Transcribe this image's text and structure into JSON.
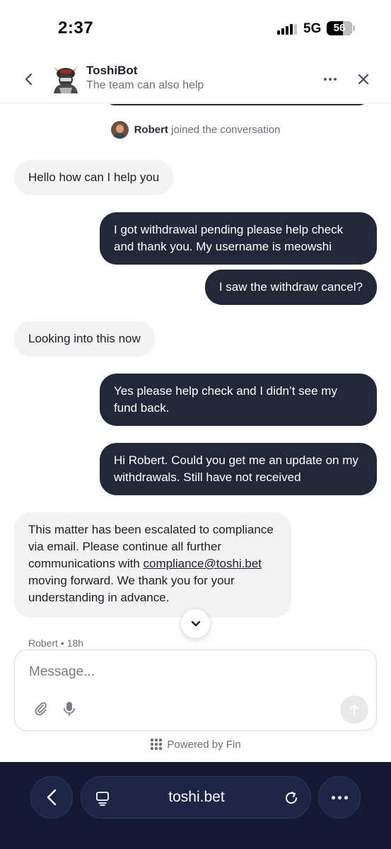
{
  "status_bar": {
    "time": "2:37",
    "network": "5G",
    "battery": "56",
    "icons": [
      "signal-icon",
      "battery-icon"
    ]
  },
  "header": {
    "bot_name": "ToshiBot",
    "subtitle": "The team can also help",
    "icons": [
      "back-chevron-icon",
      "bot-avatar",
      "more-dots-icon",
      "close-icon"
    ]
  },
  "conversation": {
    "join_notice": {
      "name": "Robert",
      "text": "joined the conversation"
    },
    "messages": [
      {
        "sender": "agent",
        "text": "Hello how can I help you"
      },
      {
        "sender": "user",
        "text": "I got withdrawal pending please help check and thank you. My username is meowshi"
      },
      {
        "sender": "user",
        "text": "I saw the withdraw cancel?"
      },
      {
        "sender": "agent",
        "text": "Looking into this now"
      },
      {
        "sender": "user",
        "text": "Yes please help check and I didn’t see my fund back."
      },
      {
        "sender": "user",
        "text": "Hi Robert. Could you get me an update on my withdrawals. Still have not received"
      },
      {
        "sender": "agent",
        "text_before": "This matter has been escalated to compliance via email. Please continue all further communications with ",
        "link": "compliance@toshi.bet",
        "text_after": " moving forward. We thank you for your understanding in advance."
      }
    ],
    "last_meta": "Robert • 18h"
  },
  "composer": {
    "placeholder": "Message...",
    "value": "",
    "icons": [
      "paperclip-icon",
      "microphone-icon",
      "send-arrow-icon"
    ]
  },
  "footer": {
    "powered_by": "Powered by Fin",
    "icons": [
      "fin-logo-icon"
    ]
  },
  "browser": {
    "url": "toshi.bet",
    "icons": [
      "browser-back-icon",
      "tabs-icon",
      "reload-icon",
      "browser-more-icon"
    ]
  },
  "colors": {
    "user_bubble": "#222838",
    "agent_bubble": "#f3f3f4",
    "browser_bar": "#131a32",
    "muted_text": "#6b6f7b"
  }
}
